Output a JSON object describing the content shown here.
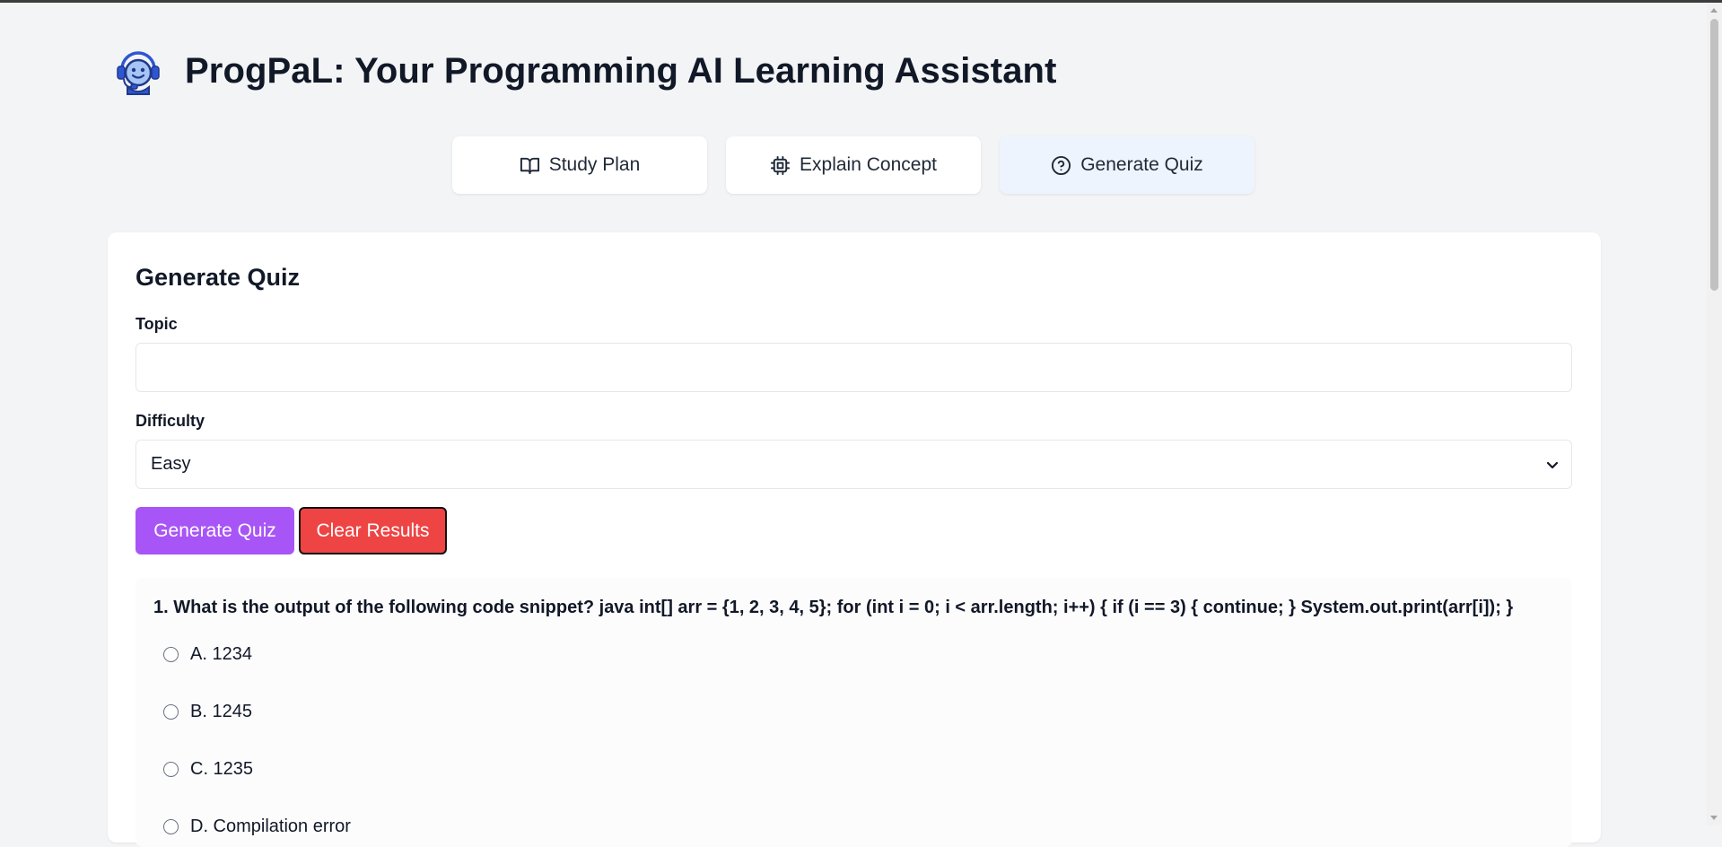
{
  "app": {
    "title": "ProgPaL: Your Programming AI Learning Assistant",
    "logo_icon": "robot-headset-icon"
  },
  "tabs": [
    {
      "label": "Study Plan",
      "icon": "book-open-icon",
      "active": false
    },
    {
      "label": "Explain Concept",
      "icon": "cpu-chip-icon",
      "active": false
    },
    {
      "label": "Generate Quiz",
      "icon": "help-circle-icon",
      "active": true
    }
  ],
  "form": {
    "title": "Generate Quiz",
    "topic_label": "Topic",
    "topic_value": "",
    "topic_placeholder": "",
    "difficulty_label": "Difficulty",
    "difficulty_value": "Easy",
    "generate_label": "Generate Quiz",
    "clear_label": "Clear Results"
  },
  "quiz": {
    "questions": [
      {
        "text": "1. What is the output of the following code snippet? java int[] arr = {1, 2, 3, 4, 5}; for (int i = 0; i < arr.length; i++) { if (i == 3) { continue; } System.out.print(arr[i]); }",
        "options": [
          "A. 1234",
          "B. 1245",
          "C. 1235",
          "D. Compilation error"
        ]
      }
    ]
  },
  "colors": {
    "background": "#f3f4f6",
    "active_tab": "#eef4fe",
    "generate_button": "#a855f7",
    "clear_button": "#ef4444",
    "logo_blue": "#2f55d4"
  }
}
